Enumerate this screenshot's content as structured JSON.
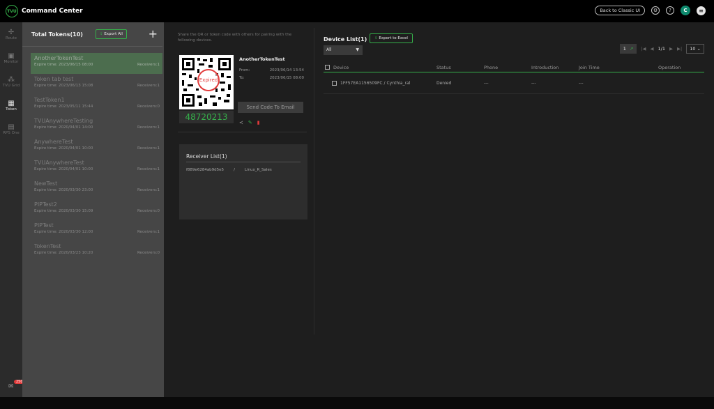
{
  "app": {
    "title": "Command Center",
    "logo_text": "TVU"
  },
  "header": {
    "classic_ui_button": "Back to Classic UI",
    "settings_icon": "gear-icon",
    "help_icon": "help-icon",
    "avatar_initial": "C"
  },
  "nav": [
    {
      "label": "Route",
      "icon": "route-icon"
    },
    {
      "label": "Monitor",
      "icon": "monitor-icon"
    },
    {
      "label": "TVU Grid",
      "icon": "grid-icon"
    },
    {
      "label": "Token",
      "icon": "qr-icon",
      "active": true
    },
    {
      "label": "RPS One",
      "icon": "rps-icon"
    }
  ],
  "mail_badge": "250",
  "tokens_panel": {
    "title": "Total Tokens(10)",
    "export_all": "Export All",
    "items": [
      {
        "name": "AnotherTokenTest",
        "expire": "Expire time: 2023/06/15 08:00",
        "receivers": "Receivers:1"
      },
      {
        "name": "Token tab test",
        "expire": "Expire time: 2023/06/13 15:08",
        "receivers": "Receivers:1"
      },
      {
        "name": "TestToken1",
        "expire": "Expire time: 2023/05/11 15:44",
        "receivers": "Receivers:0"
      },
      {
        "name": "TVUAnywhereTesting",
        "expire": "Expire time: 2020/04/01 14:00",
        "receivers": "Receivers:1"
      },
      {
        "name": "AnywhereTest",
        "expire": "Expire time: 2020/04/01 10:00",
        "receivers": "Receivers:1"
      },
      {
        "name": "TVUAnywhereTest",
        "expire": "Expire time: 2020/04/01 10:00",
        "receivers": "Receivers:1"
      },
      {
        "name": "NewTest",
        "expire": "Expire time: 2020/03/30 23:00",
        "receivers": "Receivers:1"
      },
      {
        "name": "PIPTest2",
        "expire": "Expire time: 2020/03/30 15:09",
        "receivers": "Receivers:0"
      },
      {
        "name": "PIPTest",
        "expire": "Expire time: 2020/03/30 12:00",
        "receivers": "Receivers:1"
      },
      {
        "name": "TokenTest",
        "expire": "Expire time: 2020/03/23 10:20",
        "receivers": "Receivers:0"
      }
    ]
  },
  "detail": {
    "share_hint": "Share the QR or token code with others for pairing with the following devices.",
    "token_name": "AnotherTokenTest",
    "from_label": "From:",
    "from_value": "2023/06/14 13:54",
    "to_label": "To:",
    "to_value": "2023/06/15 08:00",
    "expired_label": "Expired",
    "code": "48720213",
    "send_button": "Send Code To Email"
  },
  "receiver_list": {
    "title": "Receiver List(1)",
    "rows": [
      {
        "id": "f889e6284ab9d5e5",
        "sep": "/",
        "name": "Linux_R_Sales"
      }
    ]
  },
  "device_list": {
    "title": "Device List(1)",
    "export_excel": "Export to Excel",
    "filter_value": "All",
    "pager": {
      "current": "1",
      "total": "1/1",
      "page_size": "10"
    },
    "columns": [
      "Device",
      "Status",
      "Phone",
      "Introduction",
      "Join Time",
      "Operation"
    ],
    "rows": [
      {
        "device": "1FF57EA1156509FC / Cynthia_ral",
        "status": "Denied",
        "phone": "---",
        "introduction": "---",
        "join_time": "---"
      }
    ]
  }
}
